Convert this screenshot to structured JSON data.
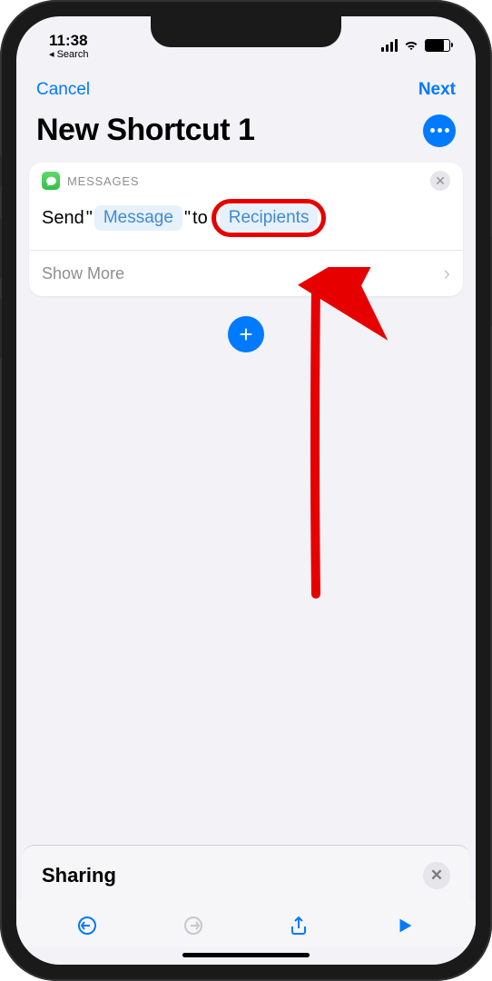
{
  "status": {
    "time": "11:38",
    "back_label": "◂ Search"
  },
  "nav": {
    "cancel": "Cancel",
    "next": "Next"
  },
  "title": "New Shortcut 1",
  "action": {
    "app_label": "MESSAGES",
    "text_prefix": "Send",
    "quote_open": "\"",
    "message_token": "Message",
    "quote_close": "\"",
    "text_mid": "to",
    "recipients_token": "Recipients",
    "show_more": "Show More"
  },
  "sharing": {
    "title": "Sharing"
  }
}
